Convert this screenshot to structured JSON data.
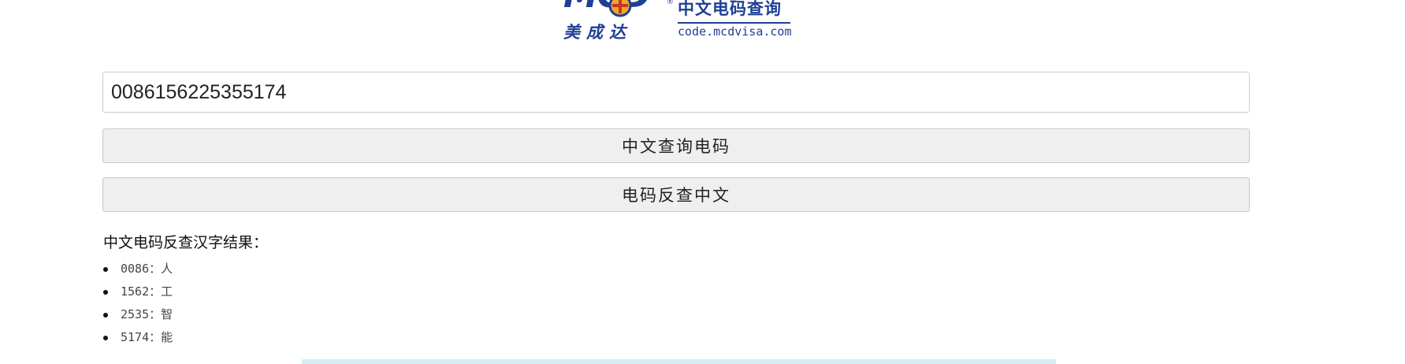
{
  "logo": {
    "mark_text": "MCD",
    "registered": "®",
    "company_cn": "美成达",
    "slogan": "中文电码查询",
    "url": "code.mcdvisa.com",
    "brand_color": "#1f3f94",
    "accent_color": "#f5a623"
  },
  "form": {
    "input_value": "0086156225355174",
    "encode_button": "中文查询电码",
    "decode_button": "电码反查中文"
  },
  "result": {
    "title": "中文电码反查汉字结果：",
    "items": [
      {
        "code": "0086",
        "sep": "：",
        "char": "人"
      },
      {
        "code": "1562",
        "sep": "：",
        "char": "工"
      },
      {
        "code": "2535",
        "sep": "：",
        "char": "智"
      },
      {
        "code": "5174",
        "sep": "：",
        "char": "能"
      }
    ]
  }
}
